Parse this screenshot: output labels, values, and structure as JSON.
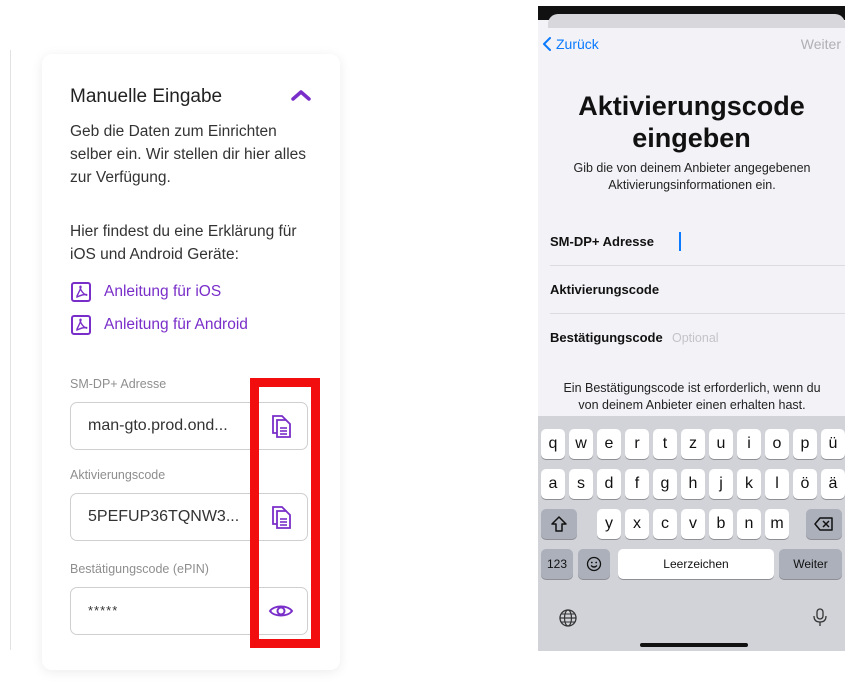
{
  "left": {
    "title": "Manuelle Eingabe",
    "intro": "Geb die Daten zum Einrichten selber ein. Wir stellen dir hier alles zur Verfügung.",
    "explain": "Hier findest du eine Erklärung für iOS und Android Geräte:",
    "links": [
      {
        "label": "Anleitung für iOS",
        "icon": "pdf-icon"
      },
      {
        "label": "Anleitung für Android",
        "icon": "pdf-icon"
      }
    ],
    "fields": [
      {
        "label": "SM-DP+ Adresse",
        "value": "man-gto.prod.ond...",
        "action_icon": "copy-icon"
      },
      {
        "label": "Aktivierungscode",
        "value": "5PEFUP36TQNW3...",
        "action_icon": "copy-icon"
      },
      {
        "label": "Bestätigungscode (ePIN)",
        "value": "*****",
        "action_icon": "eye-icon"
      }
    ],
    "accent_color": "#7a2ec9",
    "highlight_color": "#f20e0e"
  },
  "phone": {
    "nav": {
      "back": "Zurück",
      "next": "Weiter"
    },
    "title": "Aktivierungscode eingeben",
    "subtitle": "Gib die von deinem Anbieter angegebenen Aktivierungsinformationen ein.",
    "rows": [
      {
        "label": "SM-DP+ Adresse",
        "placeholder": ""
      },
      {
        "label": "Aktivierungscode",
        "placeholder": ""
      },
      {
        "label": "Bestätigungscode",
        "placeholder": "Optional"
      }
    ],
    "note": "Ein Bestätigungscode ist erforderlich, wenn du von deinem Anbieter einen erhalten hast.",
    "keyboard": {
      "row1": [
        "q",
        "w",
        "e",
        "r",
        "t",
        "z",
        "u",
        "i",
        "o",
        "p",
        "ü"
      ],
      "row2": [
        "a",
        "s",
        "d",
        "f",
        "g",
        "h",
        "j",
        "k",
        "l",
        "ö",
        "ä"
      ],
      "row3": [
        "y",
        "x",
        "c",
        "v",
        "b",
        "n",
        "m"
      ],
      "numbers": "123",
      "space": "Leerzeichen",
      "return": "Weiter"
    },
    "link_color": "#0a7aff"
  }
}
